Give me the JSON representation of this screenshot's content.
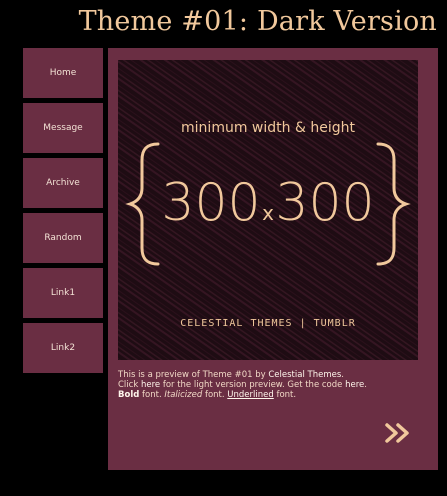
{
  "header": {
    "title": "Theme #01: Dark Version"
  },
  "nav": {
    "items": [
      {
        "label": "Home"
      },
      {
        "label": "Message"
      },
      {
        "label": "Archive"
      },
      {
        "label": "Random"
      },
      {
        "label": "Link1"
      },
      {
        "label": "Link2"
      }
    ]
  },
  "preview": {
    "line1": "minimum width & height",
    "size": "300x300",
    "size_left": "300",
    "size_x": "x",
    "size_right": "300",
    "footer": "CELESTIAL THEMES | TUMBLR"
  },
  "caption": {
    "p1_a": "This is a preview of Theme #01 by ",
    "p1_link": "Celestial Themes",
    "p1_b": ".",
    "p2_a": "Click ",
    "p2_link1": "here",
    "p2_b": " for the light version preview. Get the code ",
    "p2_link2": "here",
    "p2_c": ".",
    "p3_bold": "Bold",
    "p3_a": " font. ",
    "p3_italic": "Italicized",
    "p3_b": " font. ",
    "p3_underline": "Underlined",
    "p3_c": " font."
  },
  "colors": {
    "background": "#000000",
    "panel": "#6a2e43",
    "accent": "#f1c89c",
    "text": "#f3e2d5"
  },
  "icons": {
    "next": "double-chevron-right-icon"
  }
}
